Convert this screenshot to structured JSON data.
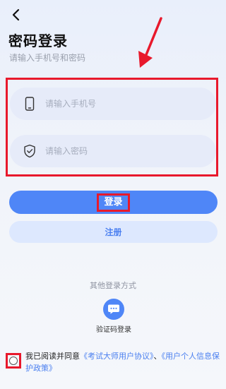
{
  "header": {
    "title": "密码登录",
    "subtitle": "请输入手机号和密码"
  },
  "form": {
    "phone_placeholder": "请输入手机号",
    "password_placeholder": "请输入密码"
  },
  "buttons": {
    "login_label": "登录",
    "register_label": "注册"
  },
  "other_login": {
    "title": "其他登录方式",
    "sms_label": "验证码登录"
  },
  "agreement": {
    "prefix": "我已阅读并同意",
    "user_agreement": "《考试大师用户协议》",
    "separator": "、",
    "privacy_policy": "《用户个人信息保护政策》"
  },
  "icons": {
    "back": "chevron-left-icon",
    "phone": "phone-icon",
    "password": "shield-check-icon",
    "sms": "chat-bubble-icon"
  },
  "colors": {
    "primary": "#4f86f7",
    "secondary": "#dde8fe",
    "annotation": "#e8192c",
    "link": "#4a7ff0"
  }
}
